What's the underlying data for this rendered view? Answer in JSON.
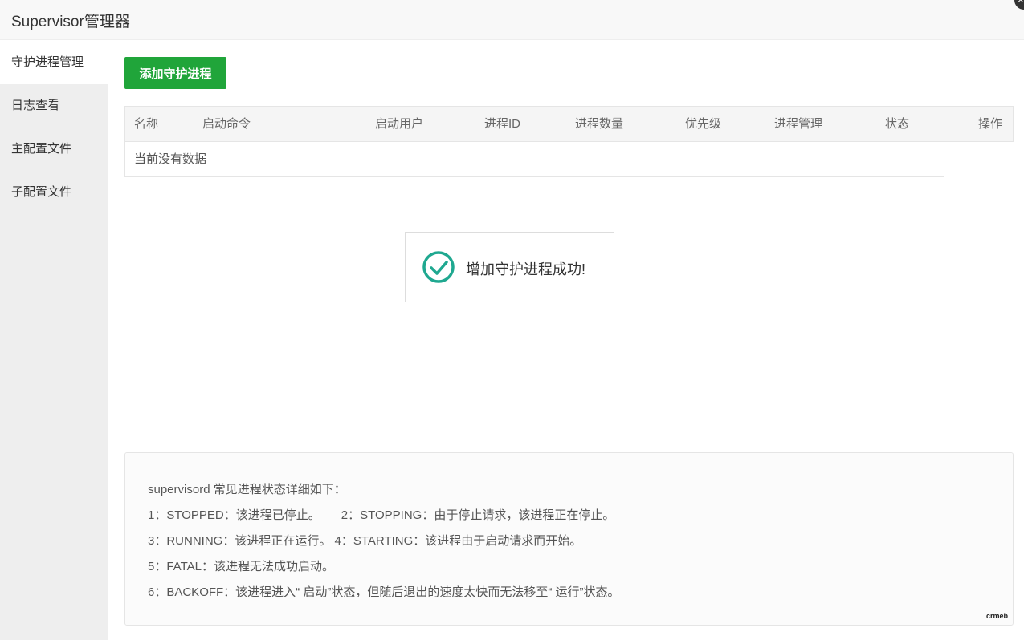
{
  "window": {
    "title": "Supervisor管理器",
    "close_icon": "×"
  },
  "sidebar": {
    "items": [
      {
        "label": "守护进程管理",
        "active": true
      },
      {
        "label": "日志查看"
      },
      {
        "label": "主配置文件"
      },
      {
        "label": "子配置文件"
      }
    ]
  },
  "toolbar": {
    "add_label": "添加守护进程",
    "add_color": "#20a53a"
  },
  "table": {
    "columns": [
      "名称",
      "启动命令",
      "启动用户",
      "进程ID",
      "进程数量",
      "优先级",
      "进程管理",
      "状态",
      "操作"
    ],
    "empty_text": "当前没有数据"
  },
  "toast": {
    "icon": "check-circle-icon",
    "icon_color": "#1fa890",
    "message": "增加守护进程成功!"
  },
  "notes": {
    "heading": "supervisord 常见进程状态详细如下：",
    "items": [
      "1：STOPPED：该进程已停止。",
      "2：STOPPING：由于停止请求，该进程正在停止。",
      "3：RUNNING：该进程正在运行。",
      "4：STARTING：该进程由于启动请求而开始。",
      "5：FATAL：该进程无法成功启动。",
      "6：BACKOFF：该进程进入“ 启动”状态，但随后退出的速度太快而无法移至“ 运行”状态。"
    ],
    "brand": "crmeb"
  }
}
